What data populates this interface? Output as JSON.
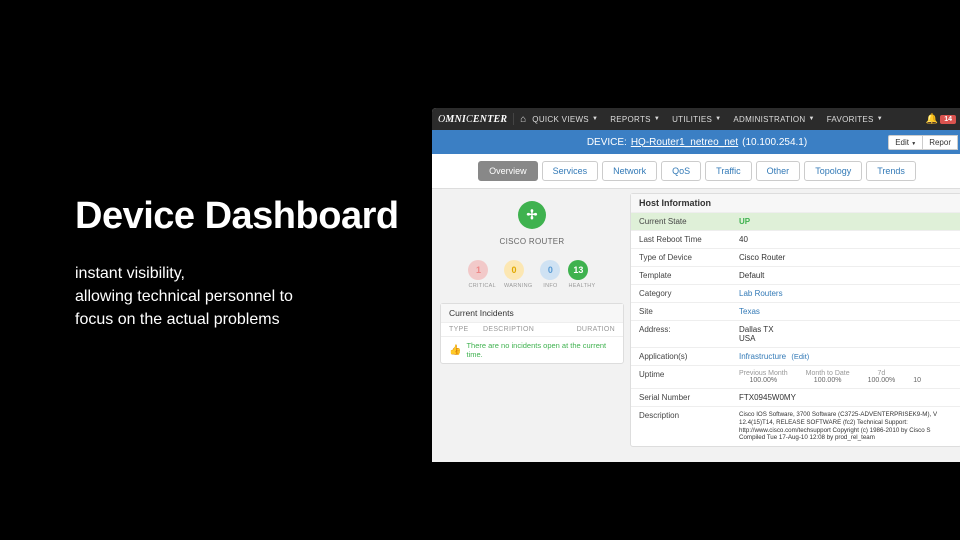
{
  "slide": {
    "title": "Device Dashboard",
    "line1": "instant visibility,",
    "line2": "allowing technical personnel to",
    "line3": "focus on the actual problems"
  },
  "topbar": {
    "brand": "OMNICENTER",
    "items": [
      "QUICK VIEWS",
      "REPORTS",
      "UTILITIES",
      "ADMINISTRATION",
      "FAVORITES"
    ],
    "alert_count": "14"
  },
  "device": {
    "label": "DEVICE:",
    "name": "HQ-Router1_netreo_net",
    "ip": "(10.100.254.1)",
    "edit_btn": "Edit",
    "report_btn": "Repor"
  },
  "tabs": [
    "Overview",
    "Services",
    "Network",
    "QoS",
    "Traffic",
    "Other",
    "Topology",
    "Trends"
  ],
  "router": {
    "label": "CISCO ROUTER"
  },
  "status": {
    "critical": {
      "n": "1",
      "l": "CRITICAL"
    },
    "warning": {
      "n": "0",
      "l": "WARNING"
    },
    "info": {
      "n": "0",
      "l": "INFO"
    },
    "healthy": {
      "n": "13",
      "l": "HEALTHY"
    }
  },
  "incidents": {
    "title": "Current Incidents",
    "col_type": "TYPE",
    "col_desc": "DESCRIPTION",
    "col_dur": "DURATION",
    "empty": "There are no incidents open at the current time."
  },
  "host": {
    "title": "Host Information",
    "rows": {
      "state_k": "Current State",
      "state_v": "UP",
      "reboot_k": "Last Reboot Time",
      "reboot_v": "40",
      "type_k": "Type of Device",
      "type_v": "Cisco Router",
      "template_k": "Template",
      "template_v": "Default",
      "category_k": "Category",
      "category_v": "Lab Routers",
      "site_k": "Site",
      "site_v": "Texas",
      "address_k": "Address:",
      "address_v1": "Dallas TX",
      "address_v2": "USA",
      "apps_k": "Application(s)",
      "apps_v": "Infrastructure",
      "apps_edit": "(Edit)",
      "uptime_k": "Uptime",
      "uptime_prev_l": "Previous Month",
      "uptime_prev_v": "100.00%",
      "uptime_mtd_l": "Month to Date",
      "uptime_mtd_v": "100.00%",
      "uptime_7d_l": "7d",
      "uptime_7d_v": "100.00%",
      "uptime_extra_v": "10",
      "serial_k": "Serial Number",
      "serial_v": "FTX0945W0MY",
      "desc_k": "Description",
      "desc_v": "Cisco IOS Software, 3700 Software (C3725-ADVENTERPRISEK9-M), V 12.4(15)T14, RELEASE SOFTWARE (fc2) Technical Support: http://www.cisco.com/techsupport Copyright (c) 1986-2010 by Cisco S Compiled Tue 17-Aug-10 12:08 by prod_rel_team"
    }
  }
}
